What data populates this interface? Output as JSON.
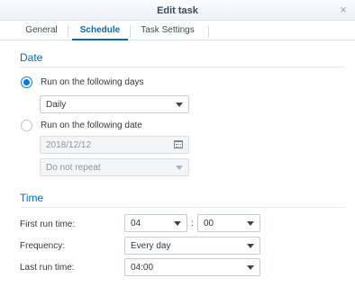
{
  "window": {
    "title": "Edit task",
    "close_glyph": "×"
  },
  "tabs": [
    {
      "label": "General"
    },
    {
      "label": "Schedule"
    },
    {
      "label": "Task Settings"
    }
  ],
  "date_section": {
    "heading": "Date",
    "option_days": {
      "label": "Run on the following days",
      "selected": true
    },
    "days_select": {
      "value": "Daily"
    },
    "option_date": {
      "label": "Run on the following date",
      "selected": false
    },
    "date_input": {
      "value": "2018/12/12"
    },
    "repeat_select": {
      "value": "Do not repeat"
    }
  },
  "time_section": {
    "heading": "Time",
    "first_run": {
      "label": "First run time:",
      "hour": "04",
      "separator": ":",
      "minute": "00"
    },
    "frequency": {
      "label": "Frequency:",
      "value": "Every day"
    },
    "last_run": {
      "label": "Last run time:",
      "value": "04:00"
    }
  },
  "colors": {
    "accent": "#0b69b8",
    "radio_active": "#0b7ad6"
  }
}
